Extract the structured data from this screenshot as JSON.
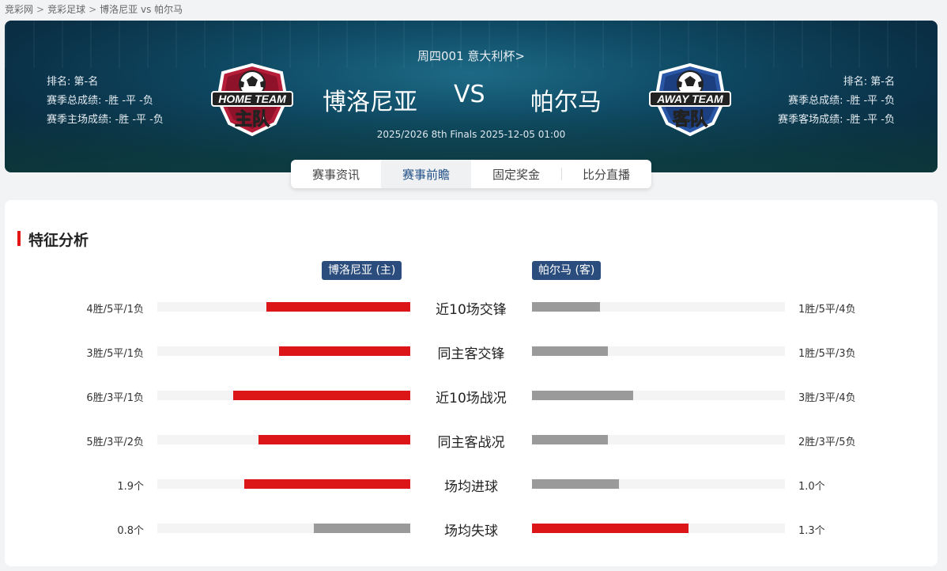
{
  "breadcrumb": [
    "竞彩网",
    "竞彩足球",
    "博洛尼亚 vs 帕尔马"
  ],
  "breadcrumb_separator": ">",
  "header": {
    "league": "周四001 意大利杯>",
    "home": {
      "name": "博洛尼亚",
      "rank": "排名: 第-名",
      "season_record": "赛季总成绩: -胜 -平 -负",
      "venue_record": "赛季主场成绩: -胜 -平 -负",
      "badge_text_top": "HOME TEAM",
      "badge_text_main": "主队"
    },
    "vs": "VS",
    "away": {
      "name": "帕尔马",
      "rank": "排名: 第-名",
      "season_record": "赛季总成绩: -胜 -平 -负",
      "venue_record": "赛季客场成绩: -胜 -平 -负",
      "badge_text_top": "AWAY TEAM",
      "badge_text_main": "客队"
    },
    "match_info": "2025/2026 8th Finals 2025-12-05 01:00"
  },
  "tabs": [
    {
      "label": "赛事资讯",
      "active": false
    },
    {
      "label": "赛事前瞻",
      "active": true
    },
    {
      "label": "固定奖金",
      "active": false
    },
    {
      "label": "比分直播",
      "active": false
    }
  ],
  "analysis": {
    "title": "特征分析",
    "home_tag": "博洛尼亚 (主)",
    "away_tag": "帕尔马 (客)",
    "rows": [
      {
        "label": "近10场交锋",
        "home_text": "4胜/5平/1负",
        "away_text": "1胜/5平/4负",
        "home_fill": 0.57,
        "away_fill": 0.27,
        "home_color": "red",
        "away_color": "gray"
      },
      {
        "label": "同主客交锋",
        "home_text": "3胜/5平/1负",
        "away_text": "1胜/5平/3负",
        "home_fill": 0.52,
        "away_fill": 0.3,
        "home_color": "red",
        "away_color": "gray"
      },
      {
        "label": "近10场战况",
        "home_text": "6胜/3平/1负",
        "away_text": "3胜/3平/4负",
        "home_fill": 0.7,
        "away_fill": 0.4,
        "home_color": "red",
        "away_color": "gray"
      },
      {
        "label": "同主客战况",
        "home_text": "5胜/3平/2负",
        "away_text": "2胜/3平/5负",
        "home_fill": 0.6,
        "away_fill": 0.3,
        "home_color": "red",
        "away_color": "gray"
      },
      {
        "label": "场均进球",
        "home_text": "1.9个",
        "away_text": "1.0个",
        "home_fill": 0.655,
        "away_fill": 0.345,
        "home_color": "red",
        "away_color": "gray"
      },
      {
        "label": "场均失球",
        "home_text": "0.8个",
        "away_text": "1.3个",
        "home_fill": 0.38,
        "away_fill": 0.62,
        "home_color": "gray",
        "away_color": "red"
      }
    ]
  },
  "colors": {
    "accent_red": "#dc1616",
    "team_tag": "#2b4d7e",
    "bar_gray": "#9a9a9a",
    "active_tab": "#1f4f86"
  }
}
